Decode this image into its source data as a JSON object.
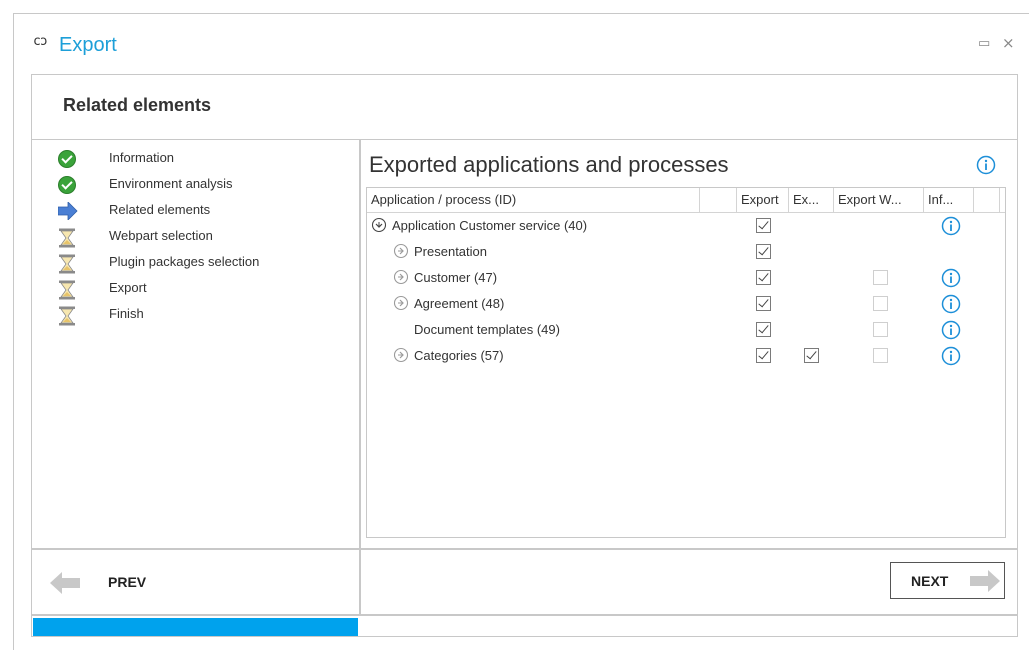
{
  "window": {
    "icon": "link-icon",
    "icon_glyph": "cɔ",
    "title": "Export",
    "accent": "#1d9fd8"
  },
  "header": {
    "title": "Related elements"
  },
  "steps": [
    {
      "label": "Information",
      "state": "done",
      "icon": "check-icon"
    },
    {
      "label": "Environment analysis",
      "state": "done",
      "icon": "check-icon"
    },
    {
      "label": "Related elements",
      "state": "current",
      "icon": "arrow-right-icon"
    },
    {
      "label": "Webpart selection",
      "state": "pending",
      "icon": "hourglass-icon"
    },
    {
      "label": "Plugin packages selection",
      "state": "pending",
      "icon": "hourglass-icon"
    },
    {
      "label": "Export",
      "state": "pending",
      "icon": "hourglass-icon"
    },
    {
      "label": "Finish",
      "state": "pending",
      "icon": "hourglass-icon"
    }
  ],
  "content": {
    "title": "Exported applications and processes",
    "columns": [
      "Application / process (ID)",
      "",
      "Export",
      "Ex...",
      "Export W...",
      "Inf..."
    ],
    "rows": [
      {
        "label": "Application Customer service (40)",
        "level": 0,
        "tree_icon": "collapse-circle-icon",
        "export": true,
        "ex": null,
        "export_w": null,
        "info": true
      },
      {
        "label": "Presentation",
        "level": 1,
        "tree_icon": "expand-circle-icon",
        "export": true,
        "ex": null,
        "export_w": null,
        "info": false
      },
      {
        "label": "Customer (47)",
        "level": 1,
        "tree_icon": "expand-circle-icon",
        "export": true,
        "ex": null,
        "export_w": false,
        "info": true
      },
      {
        "label": "Agreement (48)",
        "level": 1,
        "tree_icon": "expand-circle-icon",
        "export": true,
        "ex": null,
        "export_w": false,
        "info": true
      },
      {
        "label": "Document templates (49)",
        "level": 1,
        "tree_icon": null,
        "export": true,
        "ex": null,
        "export_w": false,
        "info": true
      },
      {
        "label": "Categories (57)",
        "level": 1,
        "tree_icon": "expand-circle-icon",
        "export": true,
        "ex": true,
        "export_w": false,
        "info": true
      }
    ]
  },
  "footer": {
    "prev_label": "PREV",
    "next_label": "NEXT"
  },
  "progress": {
    "fraction": 0.33,
    "color": "#00a2ed"
  }
}
